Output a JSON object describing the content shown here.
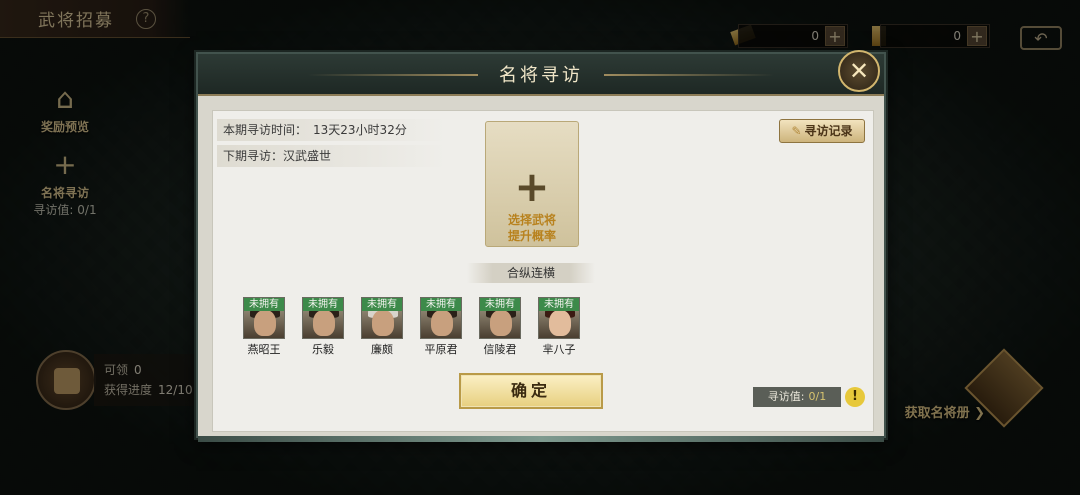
{
  "top": {
    "title": "武将招募",
    "help": "?",
    "resource1_value": "0",
    "resource2_value": "0",
    "plus": "+"
  },
  "sidebar": {
    "reward_preview": "奖励预览",
    "famous_visit": "名将寻访",
    "visit_value_label": "寻访值: 0/1"
  },
  "claim": {
    "claimable_label": "可领",
    "claimable_value": "0",
    "progress_label": "获得进度",
    "progress_value": "12/10"
  },
  "right": {
    "get_book": "获取名将册 ❯"
  },
  "dialog": {
    "title": "名将寻访",
    "close": "✕",
    "period_time_label": "本期寻访时间：",
    "period_time_value": "13天23小时32分",
    "next_period_label": "下期寻访：",
    "next_period_value": "汉武盛世",
    "select_card_plus": "+",
    "select_card_line1": "选择武将",
    "select_card_line2": "提升概率",
    "record_button": "寻访记录",
    "section_title": "合纵连横",
    "heroes": [
      {
        "tag": "未拥有",
        "name": "燕昭王"
      },
      {
        "tag": "未拥有",
        "name": "乐毅"
      },
      {
        "tag": "未拥有",
        "name": "廉颇"
      },
      {
        "tag": "未拥有",
        "name": "平原君"
      },
      {
        "tag": "未拥有",
        "name": "信陵君"
      },
      {
        "tag": "未拥有",
        "name": "芈八子"
      }
    ],
    "confirm_button": "确定",
    "visit_value_label": "寻访值:",
    "visit_value": "0/1",
    "warn": "!"
  }
}
